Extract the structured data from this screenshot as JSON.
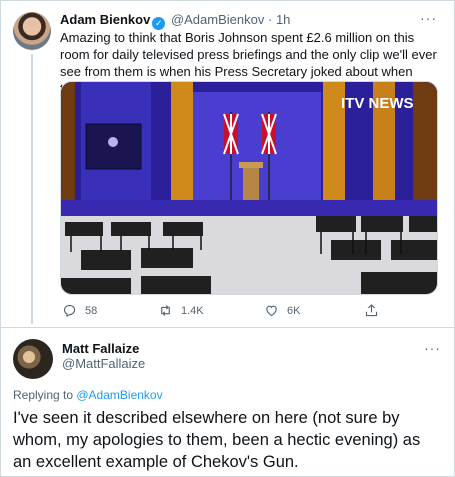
{
  "tweet1": {
    "name": "Adam Bienkov",
    "handle": "@AdamBienkov",
    "separator": "·",
    "time": "1h",
    "text": "Amazing to think that Boris Johnson spent £2.6 million on this room for daily televised press briefings and the only clip we'll ever see from them is when his Press Secretary joked about when they all broke the law.",
    "media_watermark": "ITV NEWS",
    "stats": {
      "replies": "58",
      "retweets": "1.4K",
      "likes": "6K"
    }
  },
  "tweet2": {
    "name": "Matt Fallaize",
    "handle": "@MattFallaize",
    "replying_prefix": "Replying to ",
    "replying_to": "@AdamBienkov",
    "text": "I've seen it described elsewhere on here (not sure by whom, my apologies to them, been a hectic evening) as an excellent example of Chekov's Gun."
  },
  "icons": {
    "verified": "verified-badge-icon",
    "more": "more-icon",
    "reply": "reply-icon",
    "retweet": "retweet-icon",
    "like": "heart-icon",
    "share": "share-icon"
  },
  "colors": {
    "accent": "#1d9bf0",
    "muted": "#536471",
    "border": "#cfd9de"
  }
}
